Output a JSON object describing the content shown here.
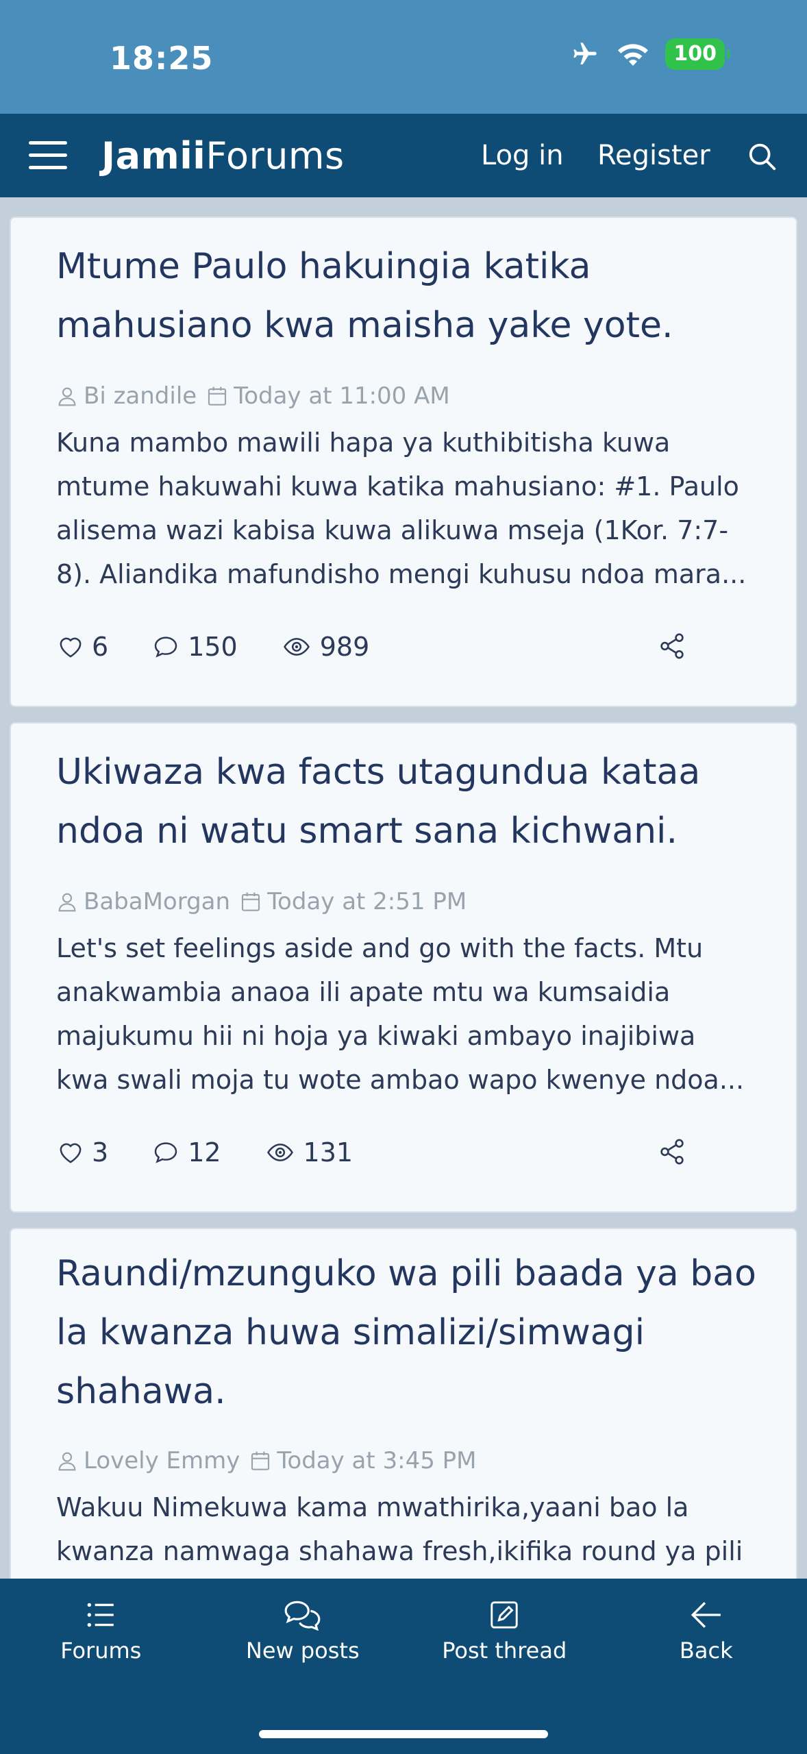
{
  "status_bar": {
    "time": "18:25",
    "battery": "100",
    "icons": [
      "airplane-icon",
      "wifi-icon",
      "battery-icon"
    ]
  },
  "header": {
    "logo_bold": "Jamii",
    "logo_light": "Forums",
    "login": "Log in",
    "register": "Register"
  },
  "threads": [
    {
      "title": "Mtume Paulo hakuingia katika mahusiano kwa maisha yake yote.",
      "author": "Bi zandile",
      "date": "Today at 11:00 AM",
      "snippet": "Kuna mambo mawili hapa ya kuthibitisha kuwa mtume hakuwahi kuwa katika mahusiano: #1. Paulo alisema wazi kabisa kuwa alikuwa mseja (1Kor. 7:7-8). Aliandika mafundisho mengi kuhusu ndoa mara...",
      "likes": "6",
      "replies": "150",
      "views": "989"
    },
    {
      "title": "Ukiwaza kwa facts utagundua kataa ndoa ni watu smart sana kichwani.",
      "author": "BabaMorgan",
      "date": "Today at 2:51 PM",
      "snippet": "Let's set feelings aside and go with the facts. Mtu anakwambia anaoa ili apate mtu wa kumsaidia majukumu hii ni hoja ya kiwaki ambayo inajibiwa kwa swali moja tu wote ambao wapo kwenye ndoa...",
      "likes": "3",
      "replies": "12",
      "views": "131"
    },
    {
      "title": "Raundi/mzunguko wa pili baada ya bao la kwanza huwa simalizi/simwagi shahawa.",
      "author": "Lovely Emmy",
      "date": "Today at 3:45 PM",
      "snippet": "Wakuu Nimekuwa kama mwathirika,yaani bao la kwanza namwaga shahawa fresh,ikifika round ya pili ndipo kasheshe"
    }
  ],
  "bottom_nav": [
    {
      "label": "Forums",
      "icon": "list-icon"
    },
    {
      "label": "New posts",
      "icon": "chat-bubbles-icon"
    },
    {
      "label": "Post thread",
      "icon": "edit-icon"
    },
    {
      "label": "Back",
      "icon": "back-arrow-icon"
    }
  ]
}
